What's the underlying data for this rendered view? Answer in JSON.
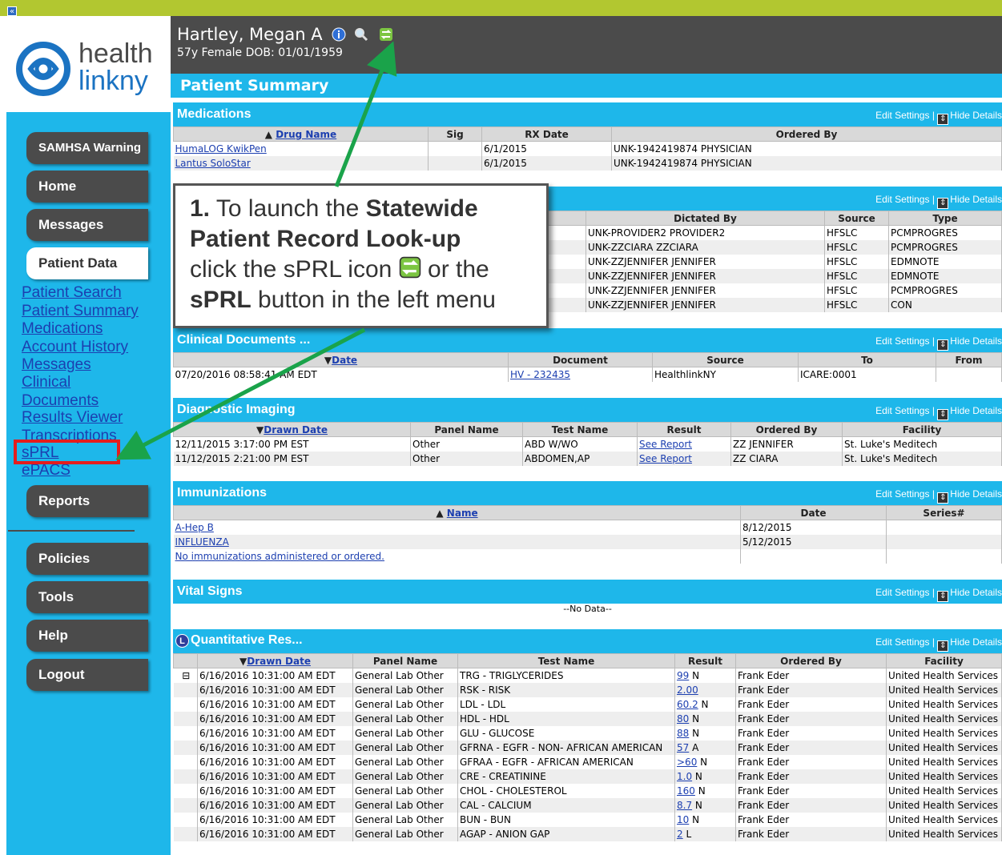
{
  "collapse_glyph": "«",
  "logo": {
    "line1": "health",
    "line2": "linkny"
  },
  "patient": {
    "name": "Hartley, Megan A",
    "demographics": "57y Female  DOB: 01/01/1959"
  },
  "page_title": "Patient  Summary",
  "nav": {
    "buttons_top": [
      "SAMHSA Warning",
      "Home",
      "Messages",
      "Patient Data"
    ],
    "sublinks": [
      "Patient Search",
      "Patient Summary",
      "Medications",
      "Account History",
      "Messages",
      "Clinical",
      "Documents",
      "Results Viewer",
      "Transcriptions",
      "sPRL",
      "ePACS"
    ],
    "buttons_bottom": [
      "Reports",
      "Policies",
      "Tools",
      "Help",
      "Logout"
    ]
  },
  "controls": {
    "edit": "Edit Settings",
    "sep": "|",
    "hide": "Hide Details"
  },
  "medications": {
    "title": "Medications",
    "headers": [
      "Drug Name",
      "Sig",
      "RX Date",
      "Ordered By"
    ],
    "rows": [
      [
        "HumaLOG KwikPen",
        "",
        "6/1/2015",
        "UNK-1942419874 PHYSICIAN"
      ],
      [
        "Lantus SoloStar",
        "",
        "6/1/2015",
        "UNK-1942419874 PHYSICIAN"
      ]
    ]
  },
  "transcriptions": {
    "headers": [
      "Dictated By",
      "Source",
      "Type"
    ],
    "rows": [
      [
        "UNK-PROVIDER2 PROVIDER2",
        "HFSLC",
        "PCMPROGRES"
      ],
      [
        "UNK-ZZCIARA ZZCIARA",
        "HFSLC",
        "PCMPROGRES"
      ],
      [
        "UNK-ZZJENNIFER JENNIFER",
        "HFSLC",
        "EDMNOTE"
      ],
      [
        "UNK-ZZJENNIFER JENNIFER",
        "HFSLC",
        "EDMNOTE"
      ],
      [
        "UNK-ZZJENNIFER JENNIFER",
        "HFSLC",
        "PCMPROGRES"
      ],
      [
        "UNK-ZZJENNIFER JENNIFER",
        "HFSLC",
        "CON"
      ]
    ]
  },
  "clinical_docs": {
    "title": "Clinical Documents ...",
    "headers": [
      "Date",
      "Document",
      "Source",
      "To",
      "From"
    ],
    "rows": [
      [
        "07/20/2016 08:58:41 AM EDT",
        "HV - 232435",
        "HealthlinkNY",
        "ICARE:0001",
        ""
      ]
    ]
  },
  "imaging": {
    "title": "Diagnostic Imaging",
    "headers": [
      "Drawn Date",
      "Panel Name",
      "Test Name",
      "Result",
      "Ordered By",
      "Facility"
    ],
    "rows": [
      [
        "12/11/2015 3:17:00 PM EST",
        "Other",
        "ABD W/WO",
        "See Report",
        "ZZ JENNIFER",
        "St. Luke's Meditech"
      ],
      [
        "11/12/2015 2:21:00 PM EST",
        "Other",
        "ABDOMEN,AP",
        "See Report",
        "ZZ CIARA",
        "St. Luke's Meditech"
      ]
    ]
  },
  "immunizations": {
    "title": "Immunizations",
    "headers": [
      "Name",
      "Date",
      "Series#"
    ],
    "rows": [
      [
        "A-Hep B",
        "8/12/2015",
        ""
      ],
      [
        "INFLUENZA",
        "5/12/2015",
        ""
      ],
      [
        "No immunizations administered or ordered.",
        "",
        ""
      ]
    ]
  },
  "vitals": {
    "title": "Vital Signs",
    "nodata": "--No Data--"
  },
  "quant": {
    "title": "Quantitative Res...",
    "headers": [
      "",
      "Drawn Date",
      "Panel Name",
      "Test Name",
      "Result",
      "Ordered By",
      "Facility"
    ],
    "rows": [
      [
        "⊟",
        "6/16/2016 10:31:00 AM EDT",
        "General Lab Other",
        "TRG - TRIGLYCERIDES",
        "99",
        "N",
        "Frank Eder",
        "United Health Services"
      ],
      [
        "",
        "6/16/2016 10:31:00 AM EDT",
        "General Lab Other",
        "RSK - RISK",
        "2.00",
        "",
        "Frank Eder",
        "United Health Services"
      ],
      [
        "",
        "6/16/2016 10:31:00 AM EDT",
        "General Lab Other",
        "LDL - LDL",
        "60.2",
        "N",
        "Frank Eder",
        "United Health Services"
      ],
      [
        "",
        "6/16/2016 10:31:00 AM EDT",
        "General Lab Other",
        "HDL - HDL",
        "80",
        "N",
        "Frank Eder",
        "United Health Services"
      ],
      [
        "",
        "6/16/2016 10:31:00 AM EDT",
        "General Lab Other",
        "GLU - GLUCOSE",
        "88",
        "N",
        "Frank Eder",
        "United Health Services"
      ],
      [
        "",
        "6/16/2016 10:31:00 AM EDT",
        "General Lab Other",
        "GFRNA - EGFR - NON- AFRICAN AMERICAN",
        "57",
        "A",
        "Frank Eder",
        "United Health Services"
      ],
      [
        "",
        "6/16/2016 10:31:00 AM EDT",
        "General Lab Other",
        "GFRAA - EGFR - AFRICAN AMERICAN",
        ">60",
        "N",
        "Frank Eder",
        "United Health Services"
      ],
      [
        "",
        "6/16/2016 10:31:00 AM EDT",
        "General Lab Other",
        "CRE - CREATININE",
        "1.0",
        "N",
        "Frank Eder",
        "United Health Services"
      ],
      [
        "",
        "6/16/2016 10:31:00 AM EDT",
        "General Lab Other",
        "CHOL - CHOLESTEROL",
        "160",
        "N",
        "Frank Eder",
        "United Health Services"
      ],
      [
        "",
        "6/16/2016 10:31:00 AM EDT",
        "General Lab Other",
        "CAL - CALCIUM",
        "8.7",
        "N",
        "Frank Eder",
        "United Health Services"
      ],
      [
        "",
        "6/16/2016 10:31:00 AM EDT",
        "General Lab Other",
        "BUN - BUN",
        "10",
        "N",
        "Frank Eder",
        "United Health Services"
      ],
      [
        "",
        "6/16/2016 10:31:00 AM EDT",
        "General Lab Other",
        "AGAP - ANION GAP",
        "2",
        "L",
        "Frank Eder",
        "United Health Services"
      ]
    ]
  },
  "callout": {
    "num": "1.",
    "t1": " To launch the ",
    "t1b": "Statewide Patient Record Look-up",
    "t2": "click the sPRL icon",
    "t3": " or the",
    "t4b": "sPRL",
    "t4": " button in the left menu"
  },
  "colors": {
    "accent": "#1eb7ea",
    "header": "#4b4b4b",
    "topbar": "#b2c730",
    "arrow": "#1aa34a",
    "highlight": "#e41d1d"
  }
}
